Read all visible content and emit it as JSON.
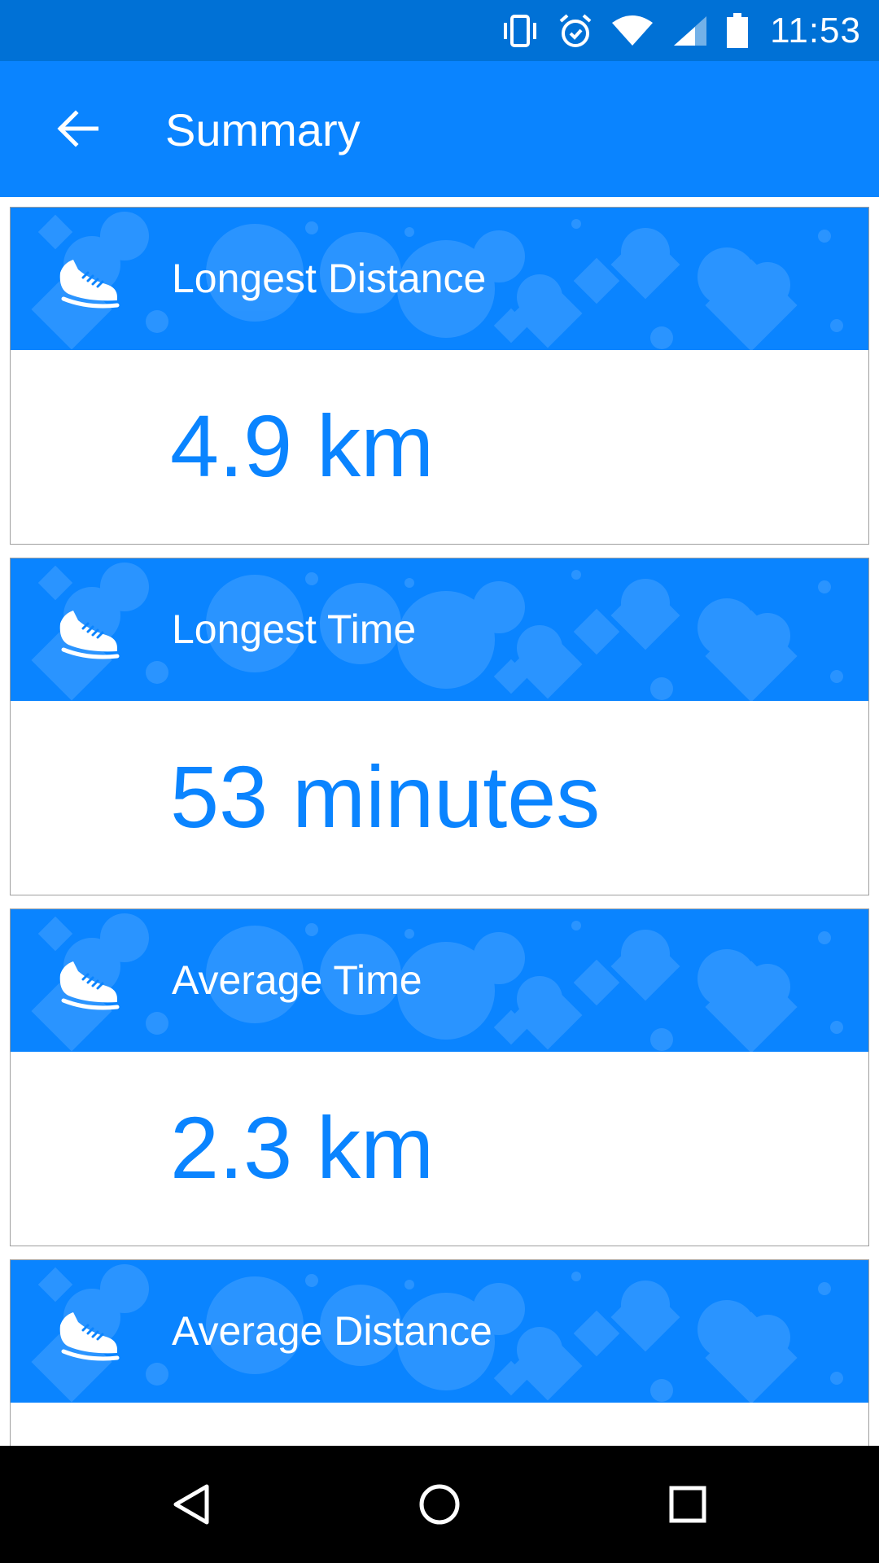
{
  "status_bar": {
    "time": "11:53",
    "icons": [
      "vibrate-icon",
      "alarm-icon",
      "wifi-icon",
      "signal-icon",
      "battery-icon"
    ],
    "background": "#0071d6"
  },
  "app_bar": {
    "title": "Summary",
    "back_icon": "arrow-back-icon",
    "background": "#0a84ff"
  },
  "cards": [
    {
      "title": "Longest Distance",
      "value": "4.9 km",
      "icon": "sneaker-icon"
    },
    {
      "title": "Longest Time",
      "value": "53 minutes",
      "icon": "sneaker-icon"
    },
    {
      "title": "Average Time",
      "value": "2.3 km",
      "icon": "sneaker-icon"
    },
    {
      "title": "Average Distance",
      "value": "",
      "icon": "sneaker-icon"
    }
  ],
  "nav_bar": {
    "buttons": [
      "back-triangle-icon",
      "home-circle-icon",
      "recents-square-icon"
    ]
  },
  "colors": {
    "accent": "#0a84ff",
    "value_text": "#0a84ff",
    "card_border": "#9e9e9e"
  }
}
